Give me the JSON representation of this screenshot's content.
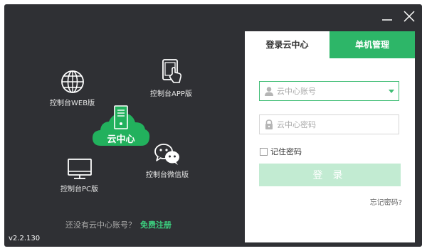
{
  "window": {
    "minimize_icon": "minimize-icon",
    "close_icon": "close-icon"
  },
  "features": {
    "web": {
      "label": "控制台WEB版",
      "icon": "globe-icon"
    },
    "app": {
      "label": "控制台APP版",
      "icon": "tablet-touch-icon"
    },
    "cloud": {
      "label": "云中心",
      "icon": "cloud-server-icon"
    },
    "wechat": {
      "label": "控制台微信版",
      "icon": "wechat-icon"
    },
    "pc": {
      "label": "控制台PC版",
      "icon": "monitor-icon"
    }
  },
  "register": {
    "prompt": "还没有云中心账号？",
    "link": "免费注册"
  },
  "version": "v2.2.130",
  "login_panel": {
    "tabs": [
      {
        "label": "登录云中心",
        "active": true
      },
      {
        "label": "单机管理",
        "active": false
      }
    ],
    "account": {
      "placeholder": "云中心账号",
      "value": ""
    },
    "password": {
      "placeholder": "云中心密码",
      "value": ""
    },
    "remember_label": "记住密码",
    "login_label": "登录",
    "forgot_label": "忘记密码?"
  },
  "colors": {
    "background": "#2f3034",
    "accent": "#2db668",
    "login_button": "#c2ebd2"
  }
}
